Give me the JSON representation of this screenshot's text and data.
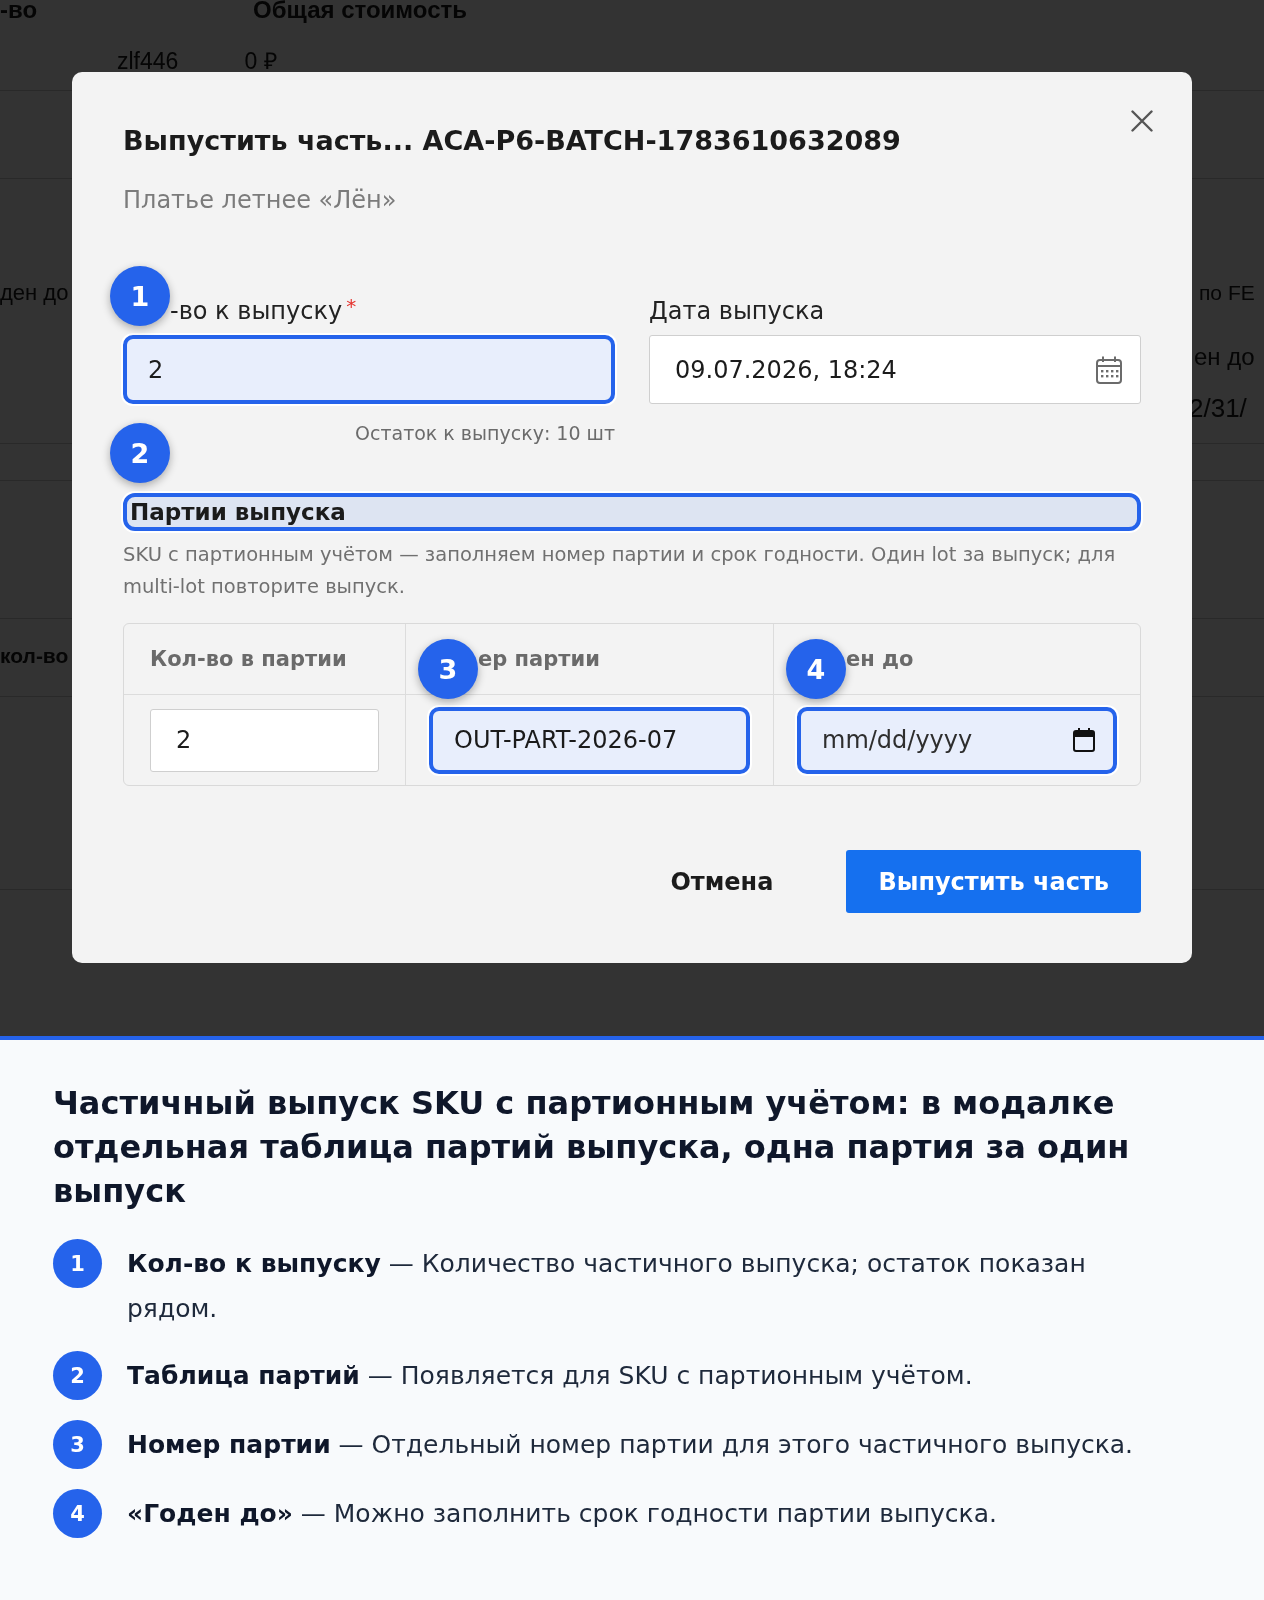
{
  "background_page": {
    "header_cells": [
      "-во",
      "Общая стоимость"
    ],
    "row_cell": "zlf446",
    "amount": {
      "value": "0",
      "currency": "₽"
    },
    "left_label": "ден до",
    "right_label": "по FE",
    "right_field_label": "ен до",
    "right_field_value": "2/31/",
    "left_column_header": "кол-во"
  },
  "modal": {
    "title": "Выпустить часть... ACA-P6-BATCH-1783610632089",
    "subtitle": "Платье летнее «Лён»",
    "fields": [
      {
        "kind": "number",
        "label": "-во к выпуску",
        "required_mark": "*",
        "value": "2",
        "highlighted": true,
        "badge": "1",
        "helper": "Остаток к выпуску: 10 шт"
      },
      {
        "kind": "datetime",
        "label": "Дата выпуска",
        "value": "09.07.2026, 18:24",
        "highlighted": false
      }
    ],
    "section": {
      "title": "Партии выпуска",
      "highlighted": true,
      "badge": "2",
      "description": "SKU с партионным учётом — заполняем номер партии и срок годности. Один lot за выпуск; для multi-lot повторите выпуск."
    },
    "table": {
      "columns": [
        {
          "label": "Кол-во в партии"
        },
        {
          "label": "ер партии",
          "badge": "3"
        },
        {
          "label": "ен до",
          "badge": "4"
        }
      ],
      "rows": [
        {
          "cells": [
            {
              "kind": "number",
              "value": "2",
              "highlighted": false
            },
            {
              "kind": "text",
              "value": "OUT-PART-2026-07",
              "highlighted": true
            },
            {
              "kind": "date",
              "placeholder": "mm/dd/yyyy",
              "highlighted": true
            }
          ]
        }
      ]
    },
    "buttons": [
      {
        "kind": "secondary",
        "label": "Отмена"
      },
      {
        "kind": "primary",
        "label": "Выпустить часть"
      }
    ]
  },
  "annotation": {
    "title": "Частичный выпуск SKU с партионным учётом: в модалке отдельная таблица партий выпуска, одна партия за один выпуск",
    "items": [
      {
        "number": "1",
        "text": "**Кол-во к выпуску** — Количество частичного выпуска; остаток показан рядом."
      },
      {
        "number": "2",
        "text": "**Таблица партий** — Появляется для SKU с партионным учётом."
      },
      {
        "number": "3",
        "text": "**Номер партии** — Отдельный номер партии для этого частичного выпуска."
      },
      {
        "number": "4",
        "text": "**«Годен до»** — Можно заполнить срок годности партии выпуска."
      }
    ]
  }
}
